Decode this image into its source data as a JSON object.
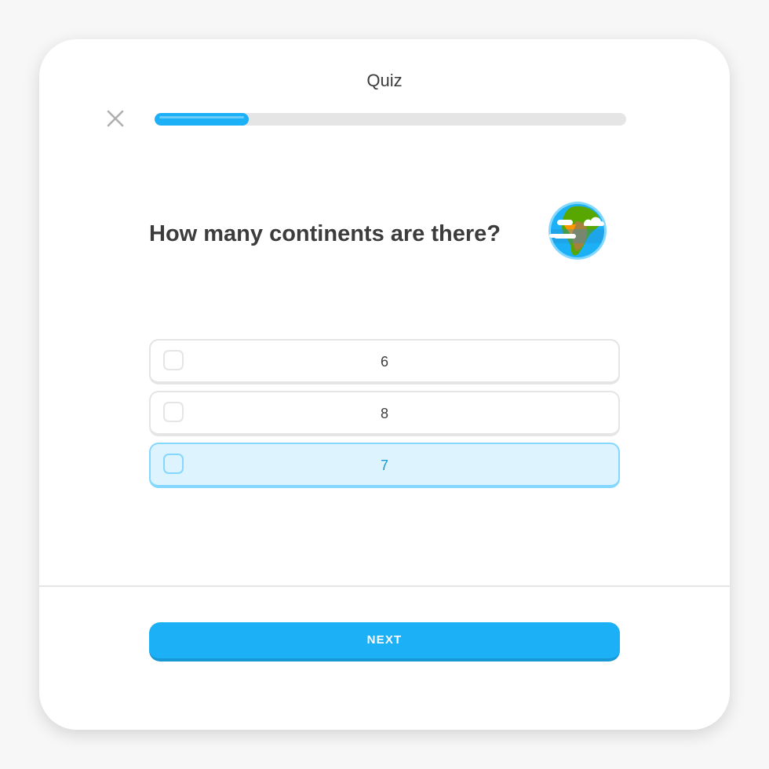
{
  "header": {
    "title": "Quiz",
    "close_icon": "close-icon",
    "progress": 0.2
  },
  "question": {
    "text": "How many continents are there?",
    "illustration": "globe-icon"
  },
  "options": [
    {
      "label": "6",
      "selected": false
    },
    {
      "label": "8",
      "selected": false
    },
    {
      "label": "7",
      "selected": true
    }
  ],
  "footer": {
    "next_label": "NEXT"
  },
  "colors": {
    "accent": "#1cb0f6",
    "accent_dark": "#1899d6",
    "selected_bg": "#ddf4ff",
    "selected_border": "#84d8ff",
    "text": "#3c3c3c",
    "border": "#e5e5e5"
  }
}
